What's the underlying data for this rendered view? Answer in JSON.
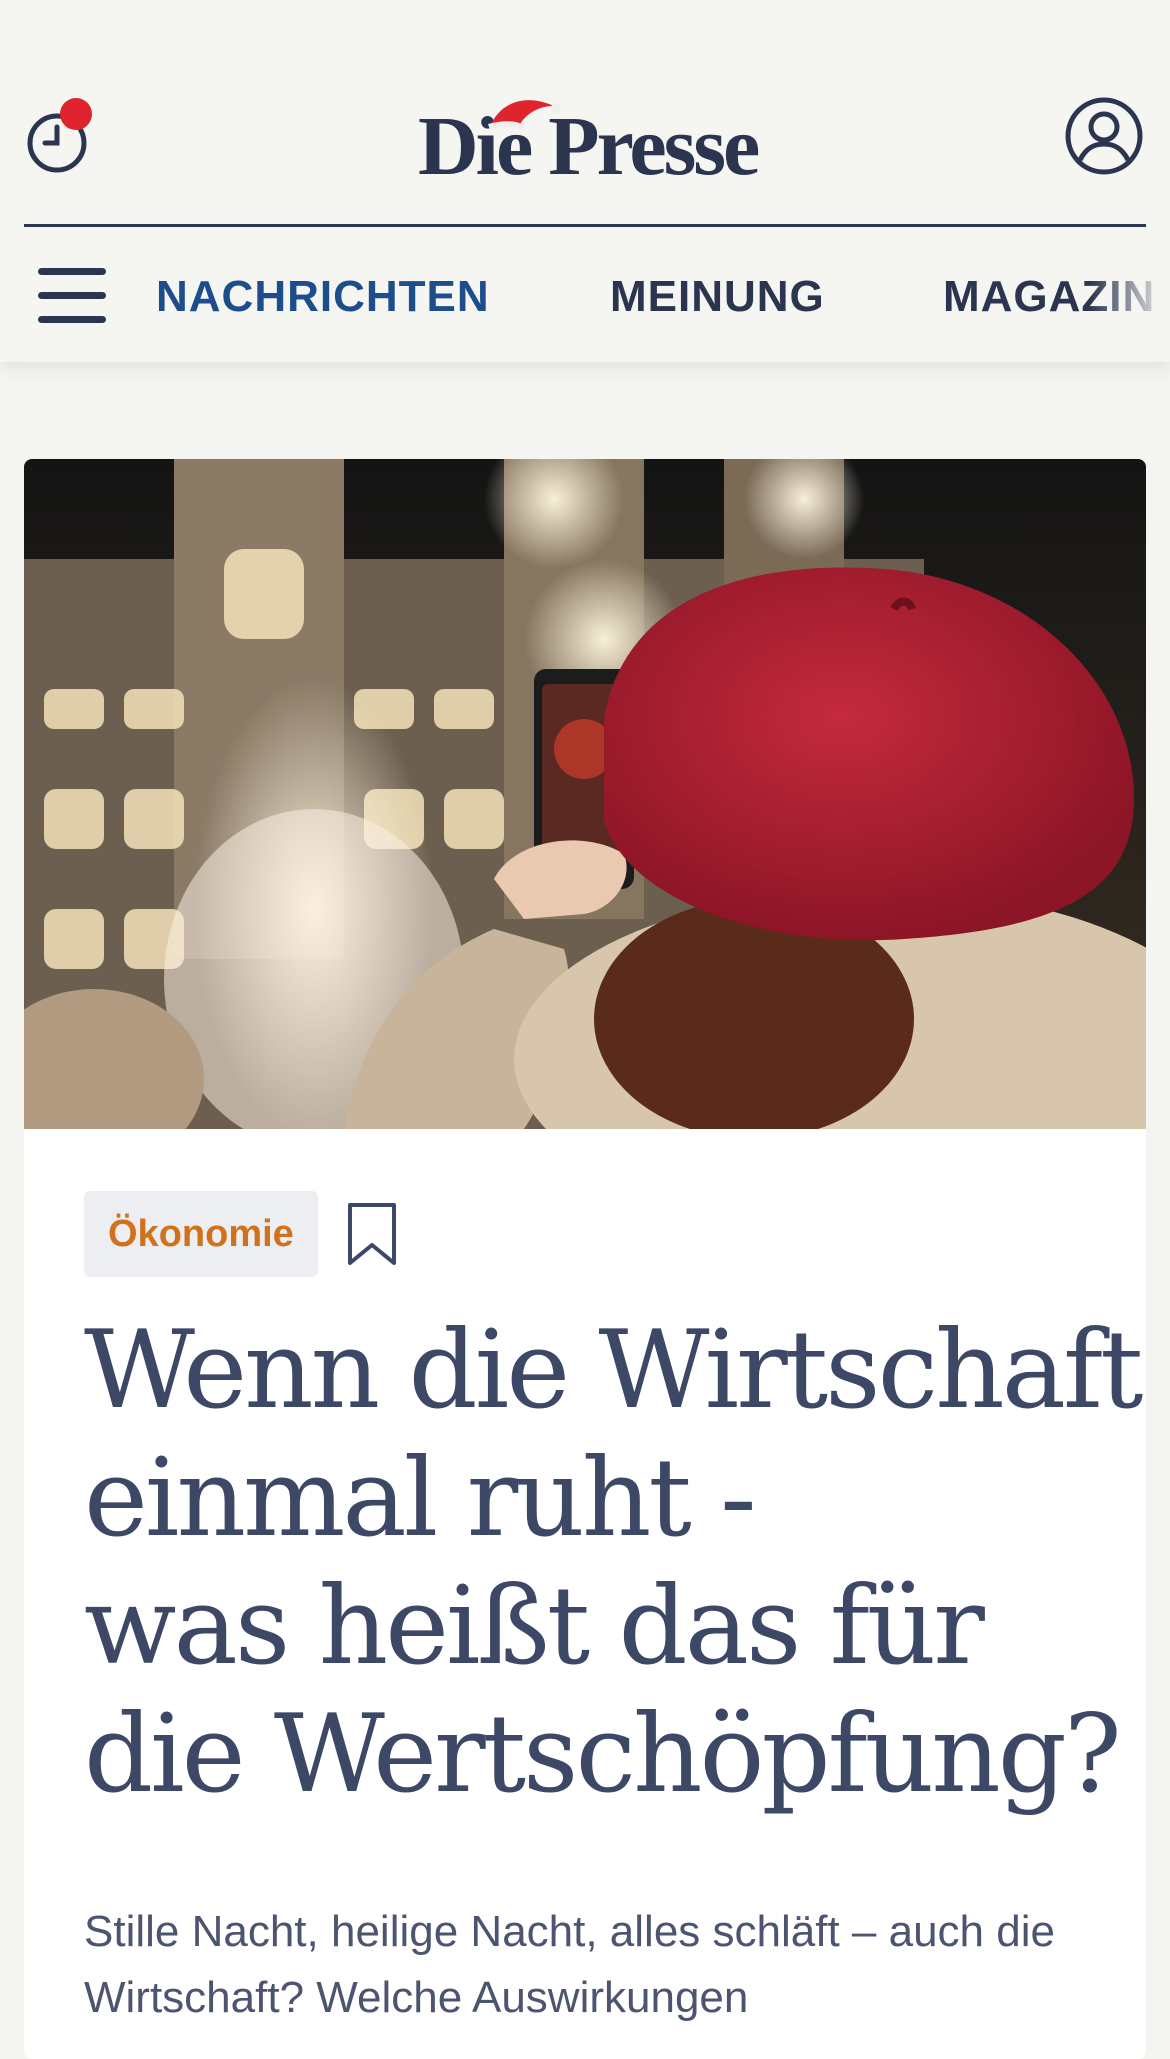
{
  "header": {
    "logo": "Die Presse",
    "history_icon": "clock-history-icon",
    "account_icon": "user-account-icon"
  },
  "nav": {
    "menu_icon": "hamburger-menu-icon",
    "items": [
      {
        "label": "NACHRICHTEN",
        "active": true
      },
      {
        "label": "MEINUNG",
        "active": false
      },
      {
        "label": "MAGAZIN",
        "active": false
      }
    ]
  },
  "article": {
    "hero_image": "Person mit roter Mütze fotografiert Weihnachtsmarkt vor dem Wiener Rathaus",
    "category": "Ökonomie",
    "bookmark_icon": "bookmark-icon",
    "headline_lines": [
      "Wenn die Wirtschaft",
      "einmal ruht -",
      "was heißt das für",
      "die Wertschöpfung?"
    ],
    "teaser": "Stille Nacht, heilige Nacht, alles schläft – auch die Wirtschaft? Welche Auswirkungen"
  },
  "colors": {
    "navy": "#2b3550",
    "nav_active": "#1d4d8c",
    "category": "#d2711c",
    "notification": "#e0242e",
    "page_bg": "#f4f4f0"
  }
}
